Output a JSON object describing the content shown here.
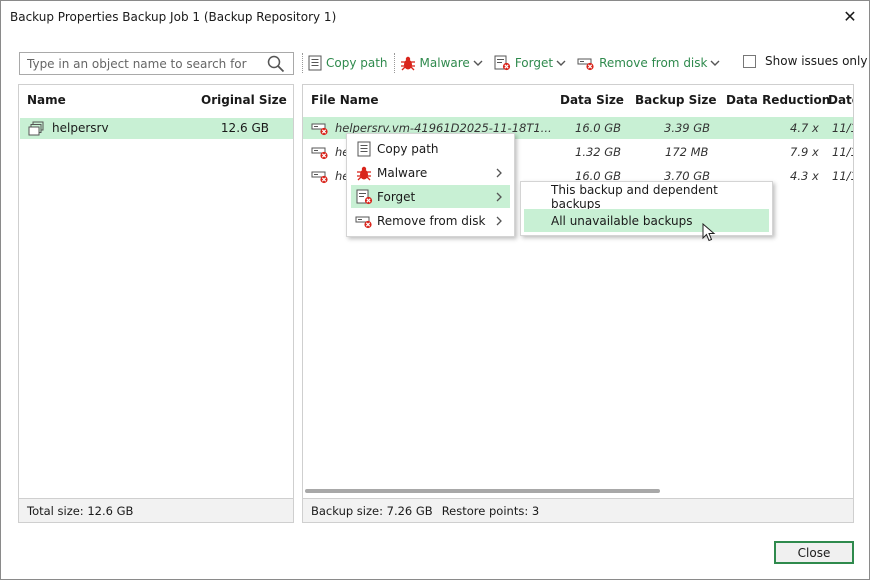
{
  "window": {
    "title": "Backup Properties Backup Job 1 (Backup Repository 1)"
  },
  "search": {
    "placeholder": "Type in an object name to search for"
  },
  "toolbar": {
    "copy_path": "Copy path",
    "malware": "Malware",
    "forget": "Forget",
    "remove_from_disk": "Remove from disk",
    "show_issues_only": "Show issues only"
  },
  "left_panel": {
    "headers": {
      "name": "Name",
      "original_size": "Original Size"
    },
    "rows": [
      {
        "name": "helpersrv",
        "original_size": "12.6 GB"
      }
    ],
    "footer": "Total size: 12.6 GB"
  },
  "right_panel": {
    "headers": {
      "file_name": "File Name",
      "data_size": "Data Size",
      "backup_size": "Backup Size",
      "data_reduction": "Data Reduction",
      "date": "Date"
    },
    "rows": [
      {
        "file_name": "helpersrv.vm-41961D2025-11-18T1...",
        "data_size": "16.0 GB",
        "backup_size": "3.39 GB",
        "data_reduction": "4.7 x",
        "date": "11/1"
      },
      {
        "file_name": "he",
        "data_size": "1.32 GB",
        "backup_size": "172 MB",
        "data_reduction": "7.9 x",
        "date": "11/1"
      },
      {
        "file_name": "he",
        "data_size": "16.0 GB",
        "backup_size": "3.70 GB",
        "data_reduction": "4.3 x",
        "date": "11/1"
      }
    ],
    "footer": {
      "backup_size": "Backup size: 7.26 GB",
      "restore_points": "Restore points: 3"
    }
  },
  "context_menu": {
    "items": [
      {
        "label": "Copy path",
        "icon": "document-icon"
      },
      {
        "label": "Malware",
        "icon": "bug-icon"
      },
      {
        "label": "Forget",
        "icon": "forget-icon"
      },
      {
        "label": "Remove from disk",
        "icon": "remove-disk-icon"
      }
    ]
  },
  "submenu": {
    "items": [
      {
        "label": "This backup and dependent backups"
      },
      {
        "label": "All unavailable backups"
      }
    ]
  },
  "buttons": {
    "close": "Close"
  },
  "colors": {
    "accent": "#2f8a4d",
    "selection": "#c8f0d4",
    "danger": "#d9251c"
  }
}
